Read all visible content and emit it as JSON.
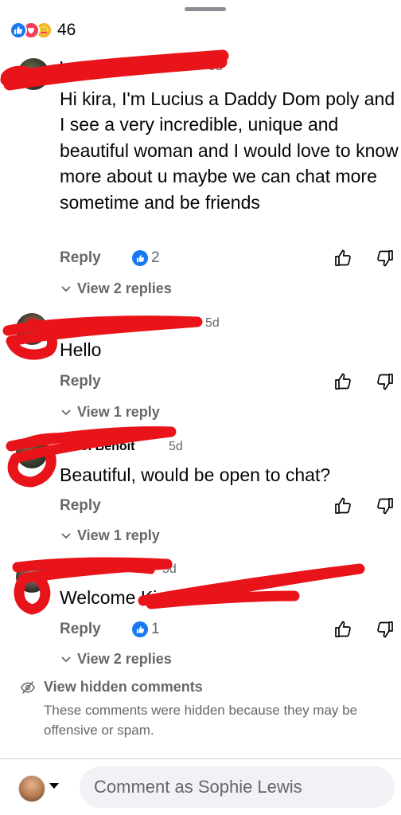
{
  "header": {
    "reaction_count": "46"
  },
  "comments": [
    {
      "name": "Lucius",
      "time": "5d",
      "text": "Hi kira, I'm Lucius a Daddy Dom poly and I see a very incredible, unique and beautiful woman and I would love to know more about u maybe we can chat more sometime and be friends",
      "reply_label": "Reply",
      "like_count": "2",
      "view_replies": "View 2 replies"
    },
    {
      "name": "",
      "time": "5d",
      "text": "Hello",
      "reply_label": "Reply",
      "view_replies": "View 1 reply"
    },
    {
      "name": "T. J. Benoit",
      "time": "5d",
      "text": "Beautiful, would be open to chat?",
      "reply_label": "Reply",
      "view_replies": "View 1 reply"
    },
    {
      "name": "",
      "time": "5d",
      "text": "Welcome Ki",
      "reply_label": "Reply",
      "like_count": "1",
      "view_replies": "View 2 replies"
    }
  ],
  "hidden": {
    "title": "View hidden comments",
    "description": "These comments were hidden because they may be offensive or spam."
  },
  "composer": {
    "placeholder": "Comment as Sophie Lewis"
  },
  "colors": {
    "accent": "#1877f2",
    "redaction": "#e8141a",
    "secondary_text": "#65676b"
  }
}
